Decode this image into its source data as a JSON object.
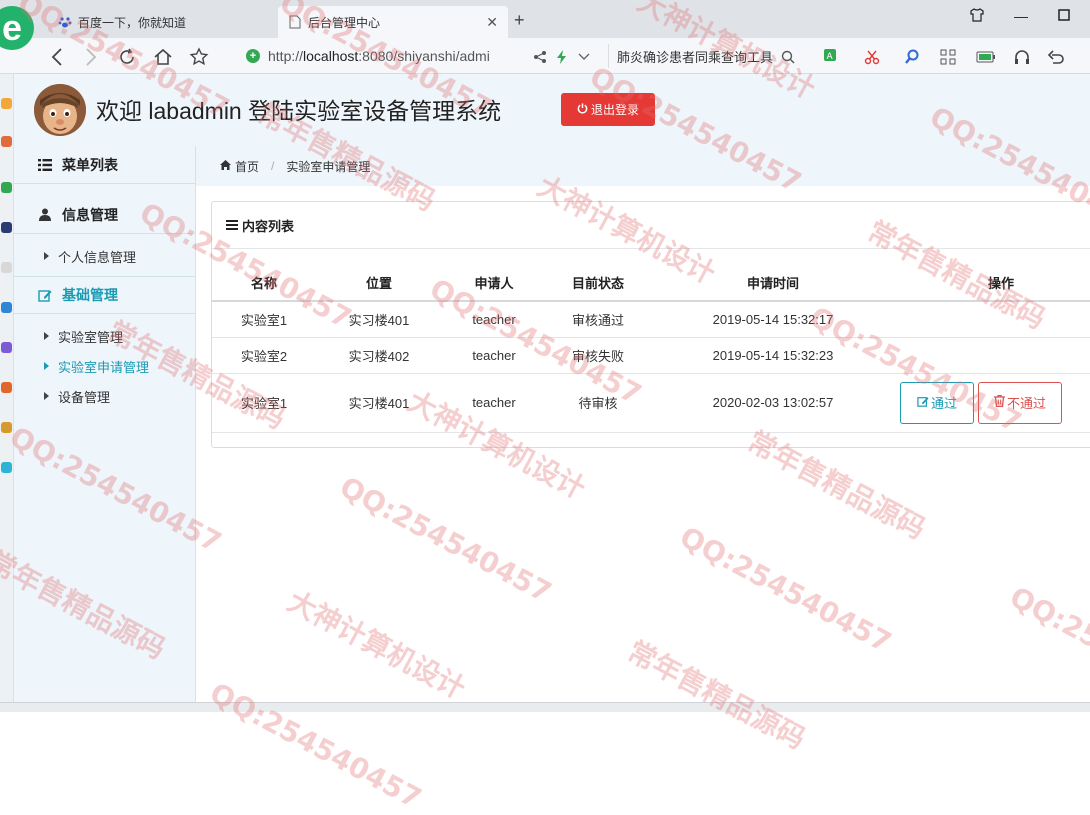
{
  "browser": {
    "tabs": [
      {
        "label": "百度一下，你就知道",
        "active": false
      },
      {
        "label": "后台管理中心",
        "active": true
      }
    ],
    "address": {
      "prefix": "http://",
      "host": "localhost",
      "rest": ":8080/shiyanshi/admi"
    },
    "search_text": "肺炎确诊患者同乘查询工具"
  },
  "header": {
    "welcome": "欢迎 labadmin 登陆实验室设备管理系统",
    "logout_label": "退出登录"
  },
  "sidebar": {
    "title": "菜单列表",
    "groups": [
      {
        "label": "信息管理",
        "items": [
          "个人信息管理"
        ]
      },
      {
        "label": "基础管理",
        "items": [
          "实验室管理",
          "实验室申请管理",
          "设备管理"
        ]
      }
    ],
    "active_item": "实验室申请管理"
  },
  "breadcrumb": {
    "home": "首页",
    "current": "实验室申请管理"
  },
  "panel": {
    "title": "内容列表",
    "columns": [
      "名称",
      "位置",
      "申请人",
      "目前状态",
      "申请时间",
      "操作"
    ],
    "rows": [
      {
        "name": "实验室1",
        "location": "实习楼401",
        "applicant": "teacher",
        "status": "审核通过",
        "time": "2019-05-14 15:32:17"
      },
      {
        "name": "实验室2",
        "location": "实习楼402",
        "applicant": "teacher",
        "status": "审核失败",
        "time": "2019-05-14 15:32:23"
      },
      {
        "name": "实验室1",
        "location": "实习楼401",
        "applicant": "teacher",
        "status": "待审核",
        "time": "2020-02-03 13:02:57"
      }
    ],
    "approve_label": "通过",
    "reject_label": "不通过"
  },
  "watermarks": [
    "QQ:254540457",
    "大神计算机设计",
    "常年售精品源码"
  ]
}
